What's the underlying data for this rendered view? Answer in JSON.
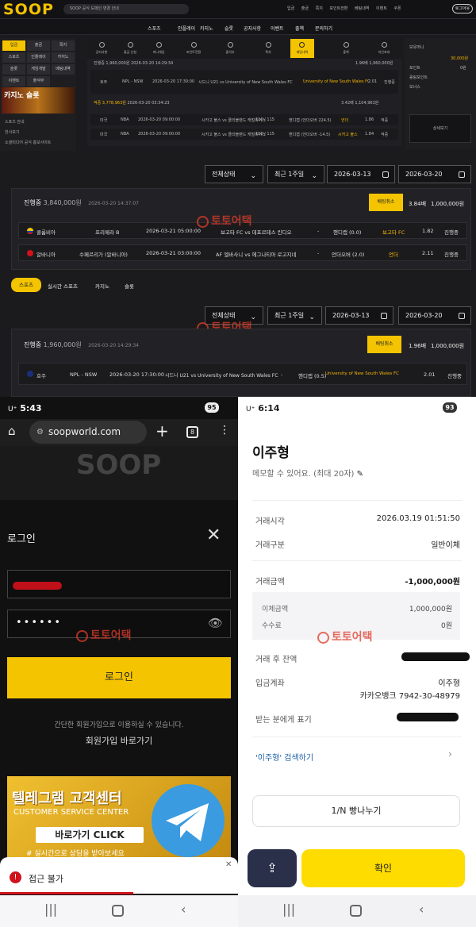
{
  "site": {
    "logo": "SOOP",
    "notice": "SOOP 공식 도메인 변경 안내",
    "toplinks": [
      "입금",
      "출금",
      "쪽지",
      "포인트전환",
      "베팅내역",
      "이벤트",
      "쿠폰"
    ],
    "logout": "로그아웃",
    "menu": [
      "스포츠",
      "인플레이",
      "카지노",
      "슬롯",
      "공지사항",
      "이벤트",
      "출첵",
      "문의하기"
    ],
    "leftpanel_buttons": [
      "입금",
      "출금",
      "쪽지",
      "스포츠",
      "인플레이",
      "카지노",
      "슬롯",
      "게임개발",
      "베팅내역",
      "이벤트",
      "출석부"
    ],
    "casino_banner": "카지노 슬롯",
    "sidebar_links": [
      "스포츠 안내",
      "천사보기",
      "소셜미디어 공식 홍보사이트"
    ],
    "navicons": [
      "공지사항",
      "출금 신청",
      "미니게임",
      "포인트전환",
      "출석부",
      "쪽지",
      "베팅내역",
      "출첵",
      "지인초대"
    ],
    "mini_rows": [
      {
        "status": "진행중",
        "amount": "1,960,000원",
        "date": "2026-03-20 14:29:34",
        "odds": "1.96배",
        "win": "1,960,000원"
      },
      {
        "status": "적중",
        "amount": "3,778,963원",
        "date": "2026-03-20 03:34:23",
        "odds": "3.42배",
        "win": "1,104,963원"
      }
    ],
    "mini_match_1": {
      "country": "호주",
      "league": "NPL - NSW",
      "time": "2026-03-20 17:30:00",
      "teams": "시드니 U21 vs University of New South Wales FC",
      "pick": "University of New South Wales FC",
      "odds": "2.01",
      "status": "진행중"
    },
    "mini_match_2": {
      "country": "미국",
      "league": "NBA",
      "time": "2026-03-20 09:00:00",
      "teams": "시카고 불스 vs 클리블랜드 캐벌리어스",
      "score": "110 / 115",
      "market": "핸디캡 (언더오버 224.5)",
      "pick": "언더",
      "odds": "1.86",
      "status": "적중"
    },
    "mini_match_3": {
      "country": "미국",
      "league": "NBA",
      "time": "2026-03-20 09:00:00",
      "teams": "시카고 불스 vs 클리블랜드 캐벌리어스",
      "score": "110 / 115",
      "market": "핸디캡 (언더오버 -14.5)",
      "pick": "시카고 불스",
      "odds": "1.84",
      "status": "적중"
    },
    "rightpanel": [
      "보유머니",
      "30,000원",
      "포인트",
      "0원",
      "롤링포인트",
      "보너스",
      "상세보기"
    ]
  },
  "filters": {
    "status": "전체상태",
    "period": "최근 1주일",
    "date_from": "2026-03-13",
    "date_to": "2026-03-20"
  },
  "bet1": {
    "status": "진행중",
    "amount": "3,840,000원",
    "datetime": "2026-03-20 14:37:07",
    "cancel": "배팅취소",
    "odds": "3.84배",
    "win": "1,000,000원",
    "rows": [
      {
        "country": "콜롬비아",
        "league": "프리메라 B",
        "time": "2026-03-21 05:00:00",
        "match": "보고타 FC vs 데포르테스 킨디오",
        "dash": "-",
        "market": "핸디캡 (0.0)",
        "pick": "보고타 FC",
        "odds": "1.82",
        "status": "진행중"
      },
      {
        "country": "알바니아",
        "league": "수페르리가 (알바니아)",
        "time": "2026-03-21 03:00:00",
        "match": "AF 엘바사니 vs 에그나티아 로고지네",
        "dash": "-",
        "market": "언더오버 (2.0)",
        "pick": "언더",
        "odds": "2.11",
        "status": "진행중"
      }
    ]
  },
  "subtabs": [
    "스포츠",
    "실시간 스포츠",
    "카지노",
    "슬롯"
  ],
  "bet2": {
    "status": "진행중",
    "amount": "1,960,000원",
    "datetime": "2026-03-20 14:29:34",
    "cancel": "배팅취소",
    "odds": "1.96배",
    "win": "1,000,000원",
    "row": {
      "country": "호주",
      "league": "NPL - NSW",
      "time": "2026-03-20 17:30:00",
      "match": "시드니 U21 vs University of New South Wales FC",
      "dash": "-",
      "market": "핸디캡 (0.5)",
      "pick": "University of New South Wales FC",
      "odds": "2.01",
      "status": "진행중"
    }
  },
  "watermark": "토토어택",
  "phoneA": {
    "time": "5:43",
    "battery": "95",
    "url": "soopworld.com",
    "tabs": "8",
    "login_title": "로그인",
    "password_dots": "••••••",
    "login_button": "로그인",
    "signup_hint": "간단한 회원가입으로 이용하실 수 있습니다.",
    "signup_link": "회원가입 바로가기",
    "banner_title": "텔레그램 고객센터",
    "banner_sub": "CUSTOMER SERVICE CENTER",
    "banner_btn": "바로가기 CLICK",
    "banner_note": "# 실시간으로 상담을 받아보세요",
    "toast": "접근 불가"
  },
  "phoneB": {
    "time": "6:14",
    "battery": "93",
    "name": "이주형",
    "memo": "메모할 수 있어요. (최대 20자)",
    "rows": [
      {
        "label": "거래시각",
        "value": "2026.03.19 01:51:50"
      },
      {
        "label": "거래구분",
        "value": "일반이체"
      }
    ],
    "amount_label": "거래금액",
    "amount": "-1,000,000원",
    "transfer_label": "이체금액",
    "transfer": "1,000,000원",
    "fee_label": "수수료",
    "fee": "0원",
    "balance_label": "거래 후 잔액",
    "account_label": "입금계좌",
    "account_name": "이주형",
    "account_no": "카카오뱅크 7942-30-48979",
    "display_label": "받는 분에게 표기",
    "search_link": "'이주형' 검색하기",
    "split_btn": "1/N 빵나누기",
    "confirm_btn": "확인"
  }
}
